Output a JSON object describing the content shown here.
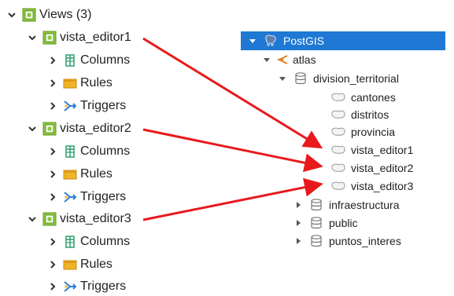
{
  "left_tree": {
    "views_label": "Views (3)",
    "views": [
      {
        "name": "vista_editor1",
        "children": [
          "Columns",
          "Rules",
          "Triggers"
        ]
      },
      {
        "name": "vista_editor2",
        "children": [
          "Columns",
          "Rules",
          "Triggers"
        ]
      },
      {
        "name": "vista_editor3",
        "children": [
          "Columns",
          "Rules",
          "Triggers"
        ]
      }
    ]
  },
  "right_tree": {
    "root": "PostGIS",
    "schema": "atlas",
    "group": "division_territorial",
    "layers": [
      "cantones",
      "distritos",
      "provincia",
      "vista_editor1",
      "vista_editor2",
      "vista_editor3"
    ],
    "other_schemas": [
      "infraestructura",
      "public",
      "puntos_interes"
    ]
  },
  "colors": {
    "selection": "#1e78d4",
    "arrow": "#e8191c",
    "view_icon": "#8cc63f",
    "columns_icon": "#2f9e6d",
    "rules_icon": "#f0b429",
    "triggers_icon": "#2f7fd9"
  }
}
